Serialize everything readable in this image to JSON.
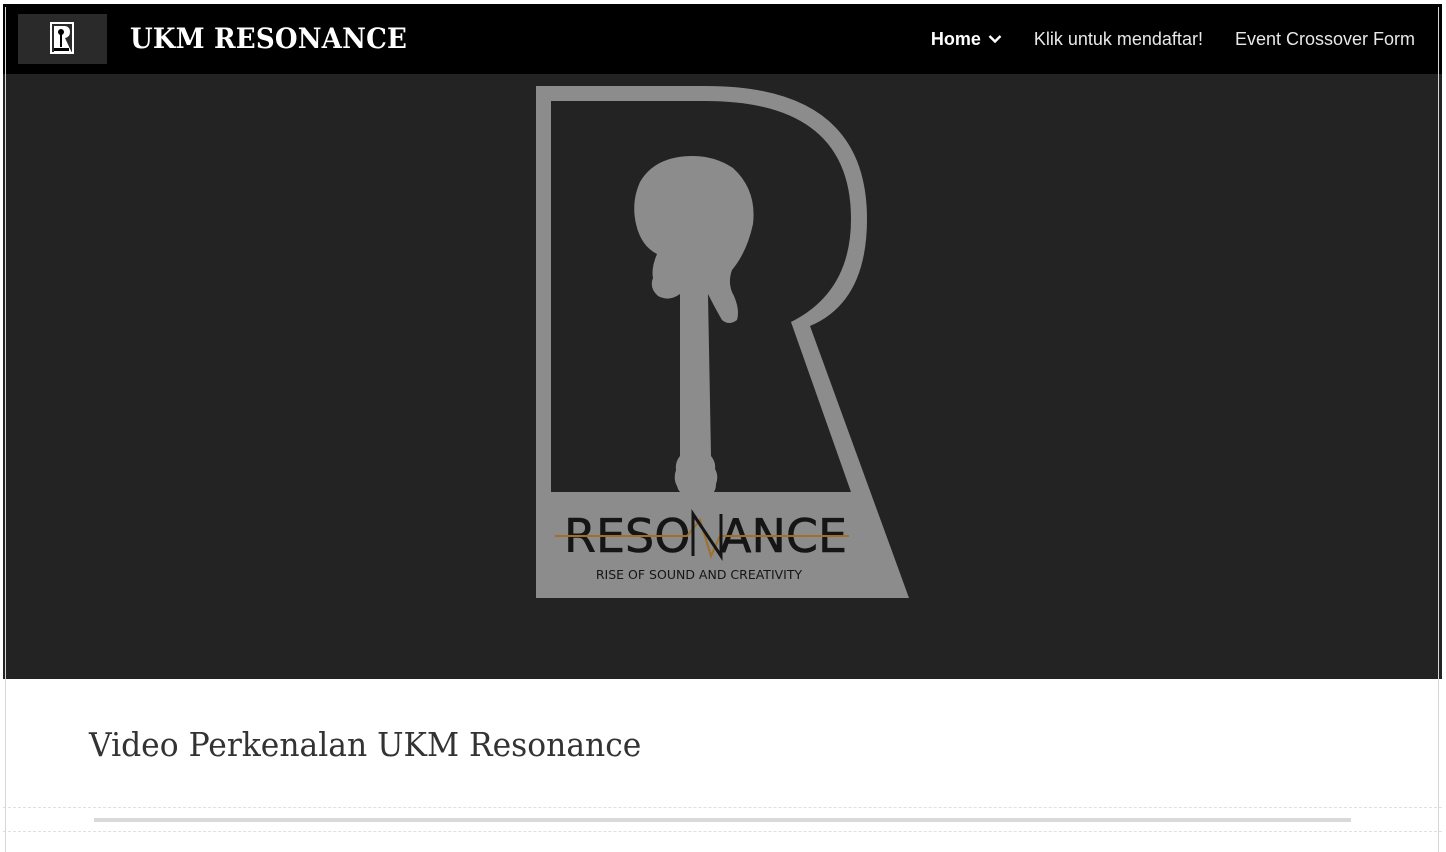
{
  "header": {
    "site_title": "UKM RESONANCE",
    "logo_icon": "resonance-logo-icon",
    "nav": [
      {
        "label": "Home",
        "active": true,
        "has_dropdown": true
      },
      {
        "label": "Klik untuk mendaftar!",
        "active": false,
        "has_dropdown": false
      },
      {
        "label": "Event Crossover Form",
        "active": false,
        "has_dropdown": false
      }
    ]
  },
  "hero": {
    "logo_wordmark": "RESONANCE",
    "logo_tagline": "RISE OF SOUND AND CREATIVITY"
  },
  "main": {
    "heading": "Video Perkenalan UKM Resonance"
  },
  "colors": {
    "header_bg": "#000000",
    "hero_bg": "#232323",
    "logo_gray": "#8c8c8c",
    "logo_accent": "#a0702a"
  }
}
